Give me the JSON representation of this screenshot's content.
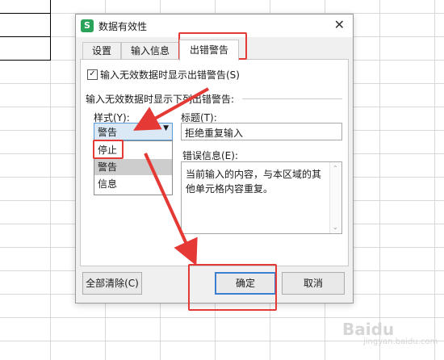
{
  "dialog": {
    "title": "数据有效性",
    "app_icon_letter": "S",
    "close_symbol": "✕"
  },
  "tabs": [
    {
      "label": "设置"
    },
    {
      "label": "输入信息"
    },
    {
      "label": "出错警告"
    }
  ],
  "error_alert": {
    "show_checkbox_label": "输入无效数据时显示出错警告(S)",
    "show_checkbox_checked": true,
    "group_label": "输入无效数据时显示下列出错警告:",
    "style_label": "样式(Y):",
    "style_value": "警告",
    "style_options": [
      "停止",
      "警告",
      "信息"
    ],
    "title_label": "标题(T):",
    "title_value": "拒绝重复输入",
    "message_label": "错误信息(E):",
    "message_value": "当前输入的内容，与本区域的其他单元格内容重复。"
  },
  "buttons": {
    "clear_all": "全部清除(C)",
    "ok": "确定",
    "cancel": "取消"
  },
  "watermark": {
    "text": "Baidu",
    "sub": "jingyan.baidu.com"
  },
  "colors": {
    "annotation_red": "#e53935",
    "wps_green": "#29a35a",
    "focus_blue": "#3c7fd1"
  }
}
